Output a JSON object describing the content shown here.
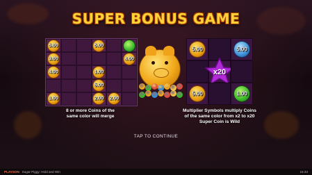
{
  "title": "SUPER BONUS GAME",
  "left_panel": {
    "coins": [
      {
        "row": 0,
        "col": 0,
        "type": "gold",
        "value": "5.00"
      },
      {
        "row": 0,
        "col": 3,
        "type": "gold",
        "value": "5.00"
      },
      {
        "row": 0,
        "col": 5,
        "type": "green",
        "value": ""
      },
      {
        "row": 1,
        "col": 0,
        "type": "gold",
        "value": "3.00"
      },
      {
        "row": 1,
        "col": 5,
        "type": "gold",
        "value": "4.00"
      },
      {
        "row": 2,
        "col": 0,
        "type": "gold",
        "value": "4.00"
      },
      {
        "row": 2,
        "col": 3,
        "type": "gold",
        "value": "1.00"
      },
      {
        "row": 3,
        "col": 3,
        "type": "gold",
        "value": "5.00"
      },
      {
        "row": 4,
        "col": 0,
        "type": "gold",
        "value": "1.00"
      },
      {
        "row": 4,
        "col": 3,
        "type": "gold",
        "value": "2.00"
      },
      {
        "row": 4,
        "col": 4,
        "type": "gold",
        "value": "2.00"
      }
    ],
    "caption_line1": "8 or more Coins of the",
    "caption_line2": "same color will merge"
  },
  "right_panel": {
    "cells": [
      {
        "row": 0,
        "col": 0,
        "type": "gold",
        "value": "5.00"
      },
      {
        "row": 0,
        "col": 2,
        "type": "blue",
        "value": "5.00"
      },
      {
        "row": 1,
        "col": 1,
        "type": "star",
        "value": "x20"
      },
      {
        "row": 2,
        "col": 0,
        "type": "gold",
        "value": "5.00"
      },
      {
        "row": 2,
        "col": 2,
        "type": "green",
        "value": "1.00"
      }
    ],
    "caption_line1": "Multiplier Symbols multiply Coins",
    "caption_line2": "of the same color from x2 to x20",
    "caption_line3": "Super Coin is Wild"
  },
  "tap_to_continue": "TAP TO CONTINUE",
  "status_bar": {
    "brand": "PLAYSON",
    "game_name": "Sugar Piggy: Hold and Win",
    "clock": "15:33"
  },
  "colors": {
    "title_gold": "#ffd23a",
    "coin_gold": "#f1a81a",
    "coin_green": "#39b82a",
    "multiplier_purple": "#b02ad6"
  }
}
